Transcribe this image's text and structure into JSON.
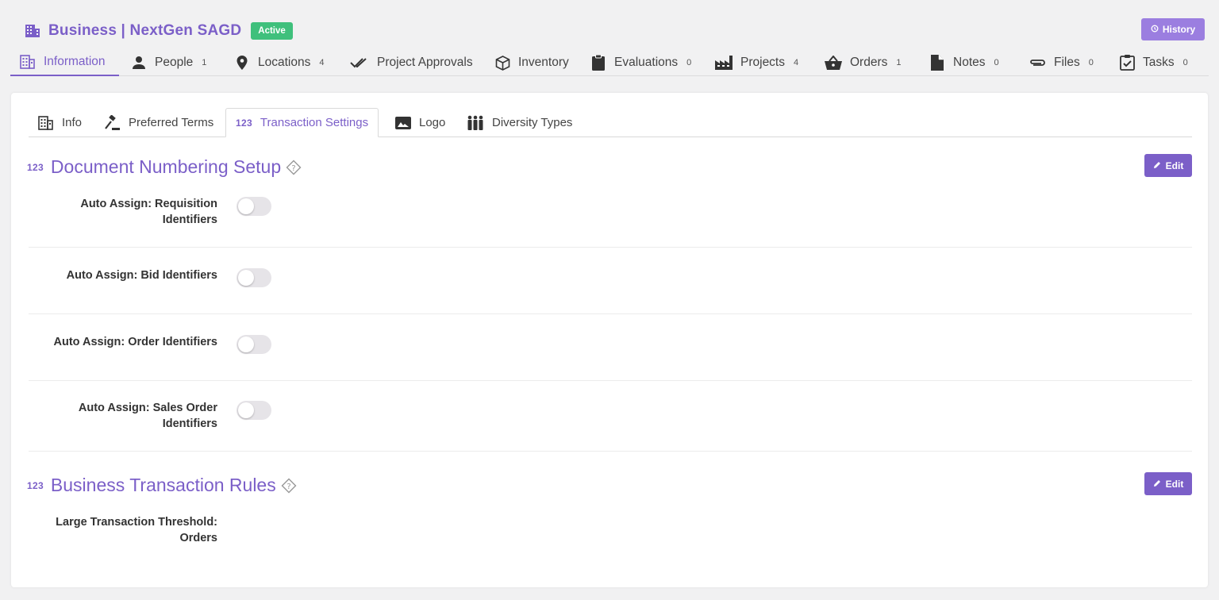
{
  "header": {
    "title": "Business | NextGen SAGD",
    "status_badge": "Active",
    "history_label": "History"
  },
  "main_tabs": [
    {
      "label": "Information",
      "count": "",
      "icon": "building-icon",
      "active": true
    },
    {
      "label": "People",
      "count": "1",
      "icon": "person-icon"
    },
    {
      "label": "Locations",
      "count": "4",
      "icon": "map-pin-icon"
    },
    {
      "label": "Project Approvals",
      "count": "",
      "icon": "double-check-icon"
    },
    {
      "label": "Inventory",
      "count": "",
      "icon": "cube-icon"
    },
    {
      "label": "Evaluations",
      "count": "0",
      "icon": "clipboard-icon"
    },
    {
      "label": "Projects",
      "count": "4",
      "icon": "factory-icon"
    },
    {
      "label": "Orders",
      "count": "1",
      "icon": "basket-icon"
    },
    {
      "label": "Notes",
      "count": "0",
      "icon": "note-icon"
    },
    {
      "label": "Files",
      "count": "0",
      "icon": "paperclip-icon"
    },
    {
      "label": "Tasks",
      "count": "0",
      "icon": "checklist-icon"
    }
  ],
  "sub_tabs": [
    {
      "label": "Info",
      "icon": "building-icon"
    },
    {
      "label": "Preferred Terms",
      "icon": "gavel-icon"
    },
    {
      "label": "Transaction Settings",
      "icon": "numbers-icon",
      "active": true
    },
    {
      "label": "Logo",
      "icon": "image-icon"
    },
    {
      "label": "Diversity Types",
      "icon": "people-icon"
    }
  ],
  "sections": {
    "numbering": {
      "title": "Document Numbering Setup",
      "badge": "123",
      "edit_label": "Edit",
      "rows": [
        {
          "label": "Auto Assign: Requisition Identifiers",
          "enabled": false
        },
        {
          "label": "Auto Assign: Bid Identifiers",
          "enabled": false
        },
        {
          "label": "Auto Assign: Order Identifiers",
          "enabled": false
        },
        {
          "label": "Auto Assign: Sales Order Identifiers",
          "enabled": false
        }
      ]
    },
    "rules": {
      "title": "Business Transaction Rules",
      "badge": "123",
      "edit_label": "Edit",
      "rows": [
        {
          "label": "Large Transaction Threshold: Orders"
        }
      ]
    }
  },
  "colors": {
    "accent": "#7b5fc8",
    "active_badge": "#3fc07c",
    "history_button": "#9b7ee0"
  }
}
